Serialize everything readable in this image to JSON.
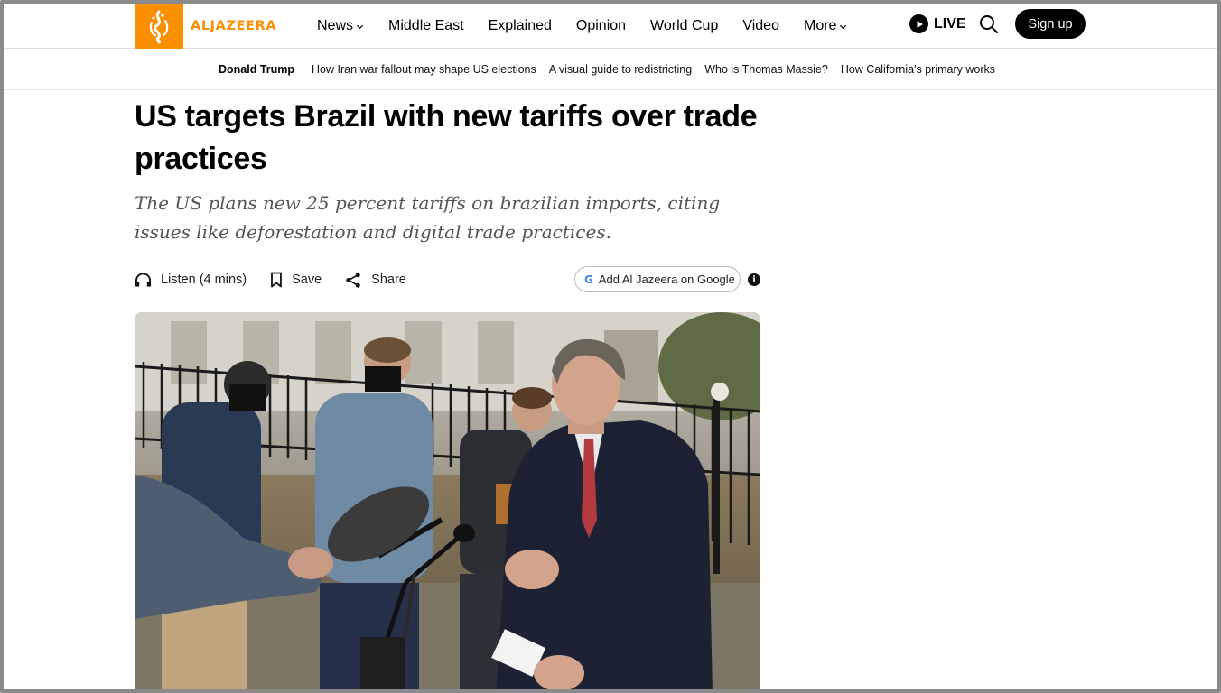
{
  "header": {
    "logo_text": "ALJAZEERA",
    "nav": [
      {
        "label": "News",
        "dropdown": true
      },
      {
        "label": "Middle East",
        "dropdown": false
      },
      {
        "label": "Explained",
        "dropdown": false
      },
      {
        "label": "Opinion",
        "dropdown": false
      },
      {
        "label": "World Cup",
        "dropdown": false
      },
      {
        "label": "Video",
        "dropdown": false
      },
      {
        "label": "More",
        "dropdown": true
      }
    ],
    "live_label": "LIVE",
    "signup_label": "Sign up"
  },
  "trending": {
    "lead": "Donald Trump",
    "links": [
      "How Iran war fallout may shape US elections",
      "A visual guide to redistricting",
      "Who is Thomas Massie?",
      "How California's primary works"
    ]
  },
  "article": {
    "headline": "US targets Brazil with new tariffs over trade practices",
    "subheadline": "The US plans new 25 percent tariffs on brazilian imports, citing issues like deforestation and digital trade practices.",
    "actions": {
      "listen": "Listen (4 mins)",
      "save": "Save",
      "share": "Share"
    },
    "google_button": "Add Al Jazeera on Google",
    "google_letter": "G",
    "info_symbol": "i"
  },
  "colors": {
    "brand_orange": "#fa9000",
    "black": "#000000",
    "subhead_gray": "#555555"
  },
  "icons": [
    "logo-calligraphy-icon",
    "chevron-down-icon",
    "play-icon",
    "search-icon",
    "headphones-icon",
    "bookmark-icon",
    "share-icon",
    "google-icon",
    "info-icon"
  ]
}
